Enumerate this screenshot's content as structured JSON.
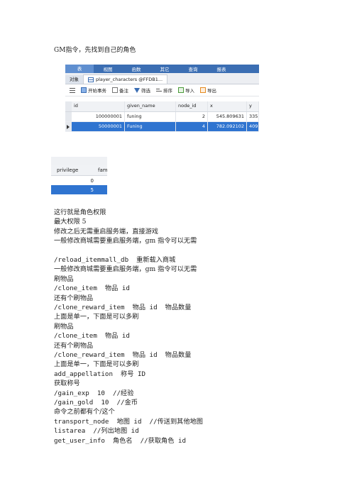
{
  "heading": "GM指令，先找到自己的角色",
  "shot1": {
    "menu": [
      "表",
      "视图",
      "函数",
      "其它",
      "查询",
      "报表"
    ],
    "tab_object": "对象",
    "tab_table": "player_characters @FFDB1...",
    "toolbar": [
      "开始事务",
      "备注",
      "筛选",
      "排序",
      "导入",
      "导出"
    ],
    "columns": [
      "id",
      "given_name",
      "node_id",
      "x",
      "y"
    ],
    "rows": [
      {
        "id": "100000001",
        "given_name": "funing",
        "node_id": "2",
        "x": "545.809631",
        "y": "335.",
        "selected": false
      },
      {
        "id": "50000001",
        "given_name": "Funing",
        "node_id": "4",
        "x": "782.092102",
        "y": "409",
        "selected": true
      }
    ]
  },
  "shot2": {
    "columns": [
      "privilege",
      "fam"
    ],
    "rows": [
      {
        "privilege": "0",
        "selected": false
      },
      {
        "privilege": "5",
        "selected": true
      }
    ]
  },
  "lines": [
    {
      "text": "这行就是角色权限",
      "mono": false
    },
    {
      "text": "最大权限 5",
      "mono": false
    },
    {
      "text": "修改之后无需重启服务端，直接游戏",
      "mono": false
    },
    {
      "text": "一般修改商城需要重启服务端，gm 指令可以无需",
      "mono": false
    },
    {
      "text": "",
      "mono": false
    },
    {
      "text": "/reload_itemmall_db  重新载入商城",
      "mono": true
    },
    {
      "text": "一般修改商城需要重启服务端，gm 指令可以无需",
      "mono": false
    },
    {
      "text": "刷物品",
      "mono": false
    },
    {
      "text": "/clone_item  物品 id",
      "mono": true
    },
    {
      "text": "还有个刷物品",
      "mono": false
    },
    {
      "text": "/clone_reward_item  物品 id  物品数量",
      "mono": true
    },
    {
      "text": "上面是单一，下面是可以多刷",
      "mono": false
    },
    {
      "text": "刷物品",
      "mono": false
    },
    {
      "text": "/clone_item  物品 id",
      "mono": true
    },
    {
      "text": "还有个刷物品",
      "mono": false
    },
    {
      "text": "/clone_reward_item  物品 id  物品数量",
      "mono": true
    },
    {
      "text": "上面是单一，下面是可以多刷",
      "mono": false
    },
    {
      "text": "add_appellation  称号 ID",
      "mono": true
    },
    {
      "text": "获取称号",
      "mono": false
    },
    {
      "text": "/gain_exp  10  //经验",
      "mono": true
    },
    {
      "text": "/gain_gold  10  //金币",
      "mono": true
    },
    {
      "text": "命令之前都有个/这个",
      "mono": false
    },
    {
      "text": "transport_node  地图 id  //传送到其他地图",
      "mono": true
    },
    {
      "text": "listarea  //列出地图 id",
      "mono": true
    },
    {
      "text": "get_user_info  角色名  //获取角色 id",
      "mono": true
    }
  ]
}
